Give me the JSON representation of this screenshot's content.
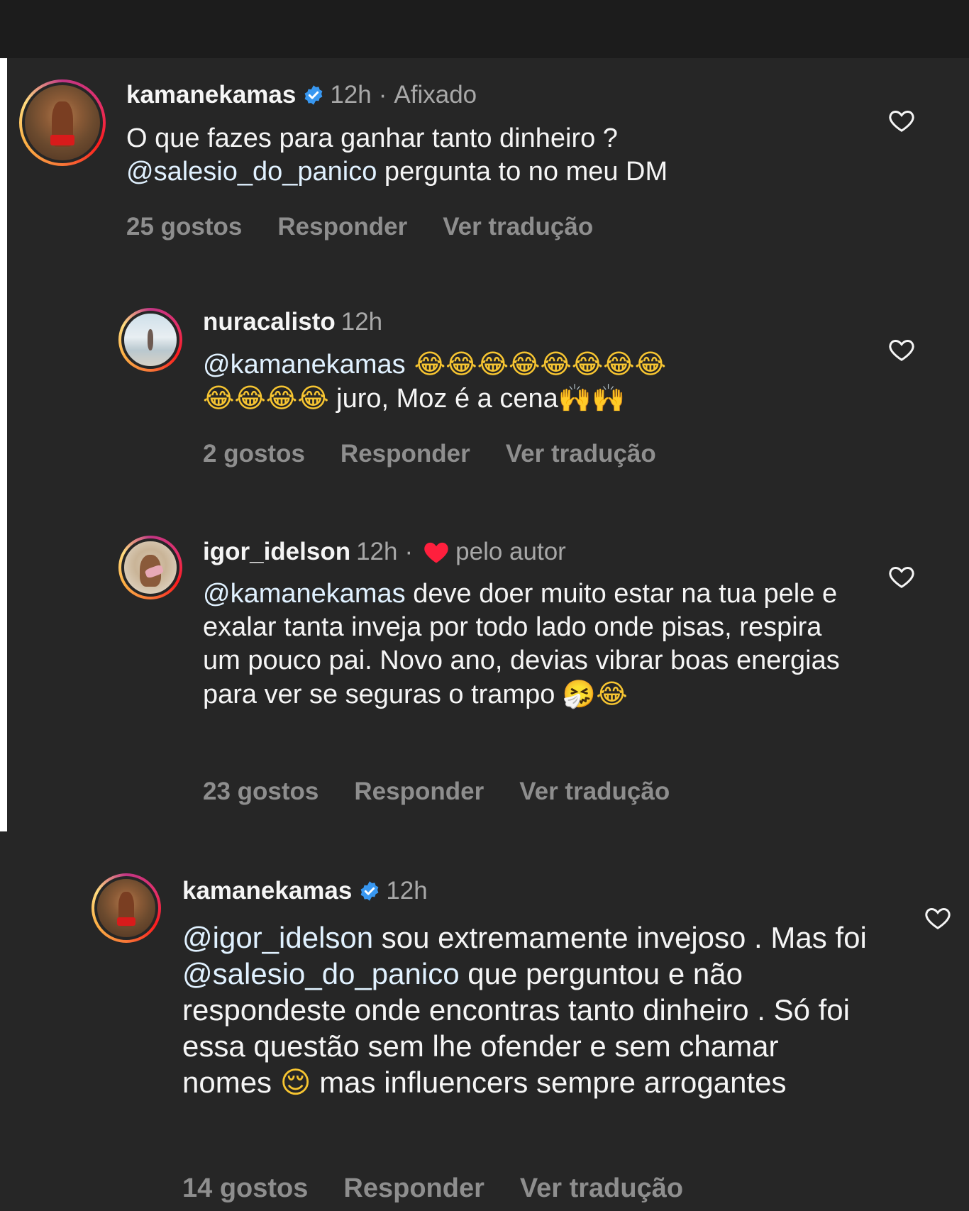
{
  "theme": {
    "background": "#262626",
    "text": "#f5f5f5",
    "secondary": "#a8a8a8",
    "verified": "#3897f0",
    "heart": "#ff1f3d"
  },
  "comments": [
    {
      "username": "kamanekamas",
      "verified": true,
      "time": "12h",
      "pinned_label": "Afixado",
      "text_before": "O que fazes para ganhar tanto dinheiro ?",
      "mention": "@salesio_do_panico",
      "text_after": " pergunta to no meu DM",
      "likes": "25 gostos",
      "reply": "Responder",
      "translate": "Ver tradução"
    },
    {
      "username": "nuracalisto",
      "time": "12h",
      "mention": "@kamanekamas",
      "emojis_line1": " 😂😂😂😂😂😂😂😂",
      "emojis_line2": "😂😂😂😂",
      "text_after": " juro, Moz é a cena",
      "emojis_end": "🙌🙌",
      "likes": "2 gostos",
      "reply": "Responder",
      "translate": "Ver tradução"
    },
    {
      "username": "igor_idelson",
      "time": "12h",
      "liked_label": "pelo autor",
      "mention": "@kamanekamas",
      "text": " deve doer muito estar na tua pele e exalar tanta inveja por todo lado onde pisas, respira um pouco pai. Novo ano, devias vibrar boas energias para ver se seguras o trampo ",
      "emojis_end": "🤧😂",
      "likes": "23 gostos",
      "reply": "Responder",
      "translate": "Ver tradução"
    },
    {
      "username": "kamanekamas",
      "verified": true,
      "time": "12h",
      "mention1": "@igor_idelson",
      "text1": " sou extremamente invejoso . Mas foi ",
      "mention2": "@salesio_do_panico",
      "text2": " que perguntou e não respondeste onde encontras tanto dinheiro . Só foi essa questão sem lhe ofender e sem chamar nomes ",
      "emoji_mid": "😌",
      "text3": " mas influencers sempre arrogantes",
      "likes": "14 gostos",
      "reply": "Responder",
      "translate": "Ver tradução"
    }
  ]
}
